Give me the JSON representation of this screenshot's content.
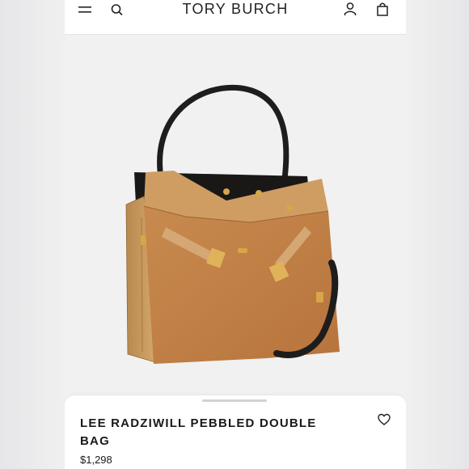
{
  "header": {
    "brand": "TORY BURCH",
    "icons": {
      "menu": "hamburger-menu-icon",
      "search": "search-icon",
      "account": "user-icon",
      "bag": "shopping-bag-icon"
    }
  },
  "product": {
    "image_alt": "Lee Radziwill pebbled double bag in tan leather",
    "title": "LEE RADZIWILL PEBBLED DOUBLE BAG",
    "price": "$1,298",
    "wishlist_icon": "heart-icon"
  },
  "colors": {
    "leather": "#c07d45",
    "leather_light": "#cd9a5c",
    "strap": "#1f1d1b",
    "hardware": "#d8a54a"
  }
}
